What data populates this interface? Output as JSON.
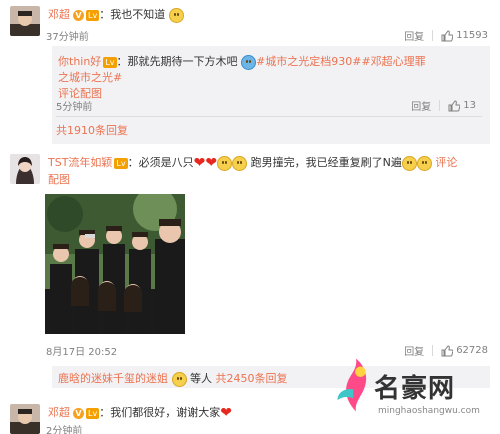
{
  "top_comment": {
    "user": "邓超",
    "badge_v": "V",
    "rank": "Lv",
    "text": "：我也不知道",
    "time": "37分钟前",
    "reply_label": "回复",
    "likes": "11593"
  },
  "reply_thread": {
    "user": "你thin好",
    "rank": "Lv",
    "text": "：那就先期待一下方木吧",
    "hashtag1": "#城市之光定档930#",
    "hashtag2": "#邓超心理罪之城市之光#",
    "pic_link": "评论配图",
    "time": "5分钟前",
    "reply_label": "回复",
    "likes": "13",
    "total_replies": "共1910条回复"
  },
  "second_comment": {
    "user": "TST流年如颖",
    "rank": "Lv",
    "text_a": "：必须是八只",
    "text_b": "跑男撞完，我已经重复刷了N遍",
    "pic_link_a": "评论",
    "pic_link_b": "配图",
    "time": "8月17日 20:52",
    "reply_label": "回复",
    "likes": "62728"
  },
  "reply_summary": {
    "user": "鹿晗的迷妹千玺的迷姐",
    "others": "等人",
    "total": "共2450条回复"
  },
  "third_comment": {
    "user": "邓超",
    "badge_v": "V",
    "rank": "Lv",
    "text": "：我们都很好，谢谢大家",
    "time": "2分钟前"
  },
  "watermark": {
    "title": "名豪网",
    "url": "minghaoshangwu.com"
  },
  "colors": {
    "link": "#eb7350",
    "muted": "#808080",
    "reply_bg": "#f2f2f5"
  }
}
